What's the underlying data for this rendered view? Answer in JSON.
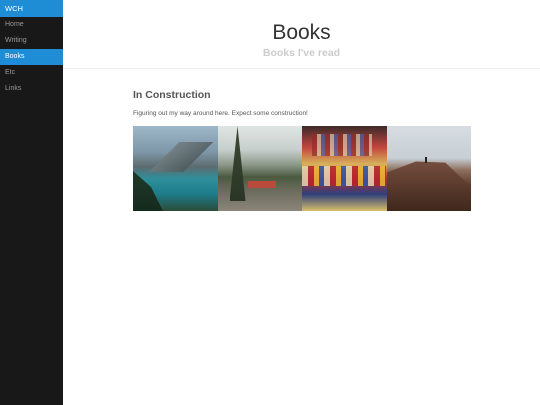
{
  "sidebar": {
    "brand": "WCH",
    "items": [
      {
        "label": "Home",
        "active": false
      },
      {
        "label": "Writing",
        "active": false
      },
      {
        "label": "Books",
        "active": true
      },
      {
        "label": "Etc",
        "active": false
      },
      {
        "label": "Links",
        "active": false
      }
    ]
  },
  "header": {
    "title": "Books",
    "subtitle": "Books I've read"
  },
  "content": {
    "section_title": "In Construction",
    "section_text": "Figuring out my way around here. Expect some construction!"
  },
  "colors": {
    "sidebar_bg": "#191818",
    "accent": "#1f8dd6",
    "nav_text": "#999999"
  }
}
